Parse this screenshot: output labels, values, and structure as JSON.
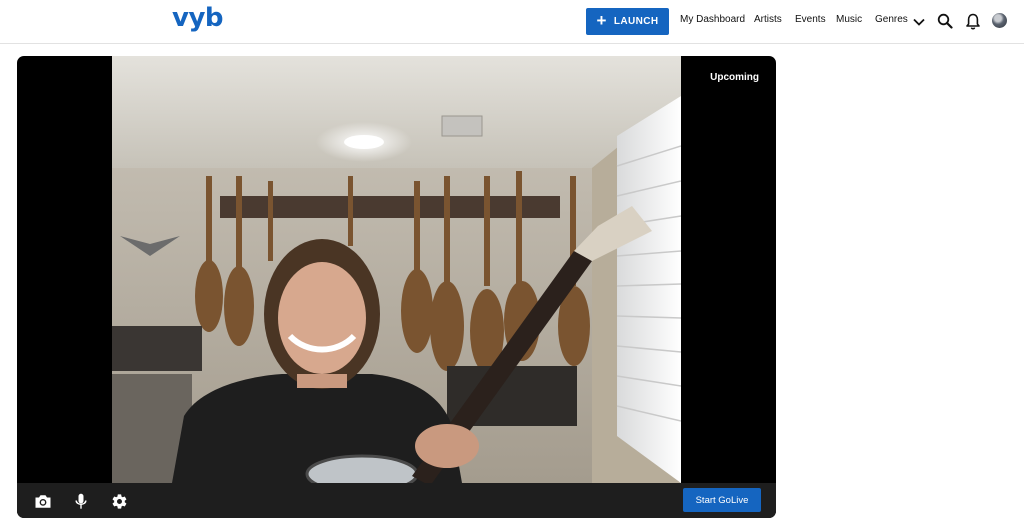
{
  "header": {
    "logo_text": "vyb",
    "launch_label": "LAUNCH",
    "nav": {
      "dashboard": "My Dashboard",
      "artists": "Artists",
      "events": "Events",
      "music": "Music",
      "genres": "Genres"
    },
    "icons": [
      "plus-icon",
      "chevron-down-icon",
      "search-icon",
      "bell-icon",
      "avatar"
    ]
  },
  "player": {
    "status": "Upcoming",
    "go_live_label": "Start GoLive",
    "controls": [
      "camera-icon",
      "microphone-icon",
      "gear-icon"
    ]
  },
  "colors": {
    "brand": "#1565c0",
    "player_bg": "#000000",
    "controls_bg": "#1e1e1e"
  }
}
